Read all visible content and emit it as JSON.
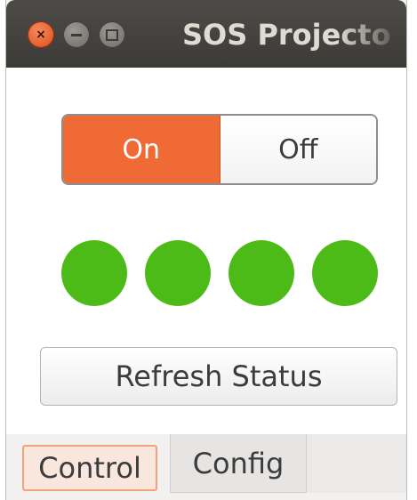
{
  "window": {
    "title": "SOS Projecto",
    "controls": {
      "close_glyph": "×",
      "close_icon": "close-icon",
      "minimize_icon": "minimize-icon",
      "maximize_icon": "maximize-icon"
    }
  },
  "power_toggle": {
    "on_label": "On",
    "off_label": "Off",
    "selected": "On",
    "active_color": "#f06a35"
  },
  "status_indicators": [
    {
      "color": "#4cbb17"
    },
    {
      "color": "#4cbb17"
    },
    {
      "color": "#4cbb17"
    },
    {
      "color": "#4cbb17"
    }
  ],
  "refresh_button": {
    "label": "Refresh Status"
  },
  "tabs": [
    {
      "label": "Control",
      "active": true
    },
    {
      "label": "Config",
      "active": false
    }
  ]
}
